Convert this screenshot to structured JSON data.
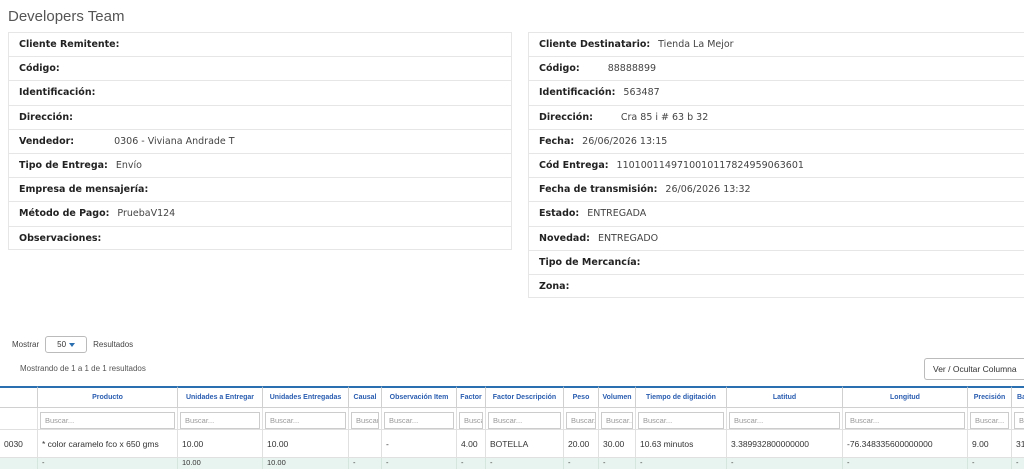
{
  "app_title": "Developers Team",
  "sender": [
    {
      "label": "Cliente Remitente:",
      "value": ""
    },
    {
      "label": "Código:",
      "value": ""
    },
    {
      "label": "Identificación:",
      "value": ""
    },
    {
      "label": "Dirección:",
      "value": ""
    },
    {
      "label": "Vendedor:",
      "value": "0306 - Viviana Andrade T"
    },
    {
      "label": "Tipo de Entrega:",
      "value": "Envío"
    },
    {
      "label": "Empresa de mensajería:",
      "value": ""
    },
    {
      "label": "Método de Pago:",
      "value": "PruebaV124"
    },
    {
      "label": "Observaciones:",
      "value": ""
    }
  ],
  "receiver": [
    {
      "label": "Cliente Destinatario:",
      "value": "Tienda La Mejor"
    },
    {
      "label": "Código:",
      "value": "88888899"
    },
    {
      "label": "Identificación:",
      "value": "563487"
    },
    {
      "label": "Dirección:",
      "value": "Cra 85 i # 63 b 32"
    },
    {
      "label": "Fecha:",
      "value": "26/06/2026 13:15"
    },
    {
      "label": "Cód Entrega:",
      "value": "1101001149710010117824959063601"
    },
    {
      "label": "Fecha de transmisión:",
      "value": "26/06/2026 13:32"
    },
    {
      "label": "Estado:",
      "value": "ENTREGADA"
    },
    {
      "label": "Novedad:",
      "value": "ENTREGADO"
    },
    {
      "label": "Tipo de Mercancía:",
      "value": ""
    },
    {
      "label": "Zona:",
      "value": ""
    }
  ],
  "table_controls": {
    "show_label": "Mostrar",
    "page_size": "50",
    "results_label": "Resultados",
    "showing_text": "Mostrando de 1 a 1 de 1 resultados",
    "toggle_columns": "Ver / Ocultar Columna"
  },
  "table": {
    "search_placeholder": "Buscar...",
    "columns": [
      "",
      "Producto",
      "Unidades a Entregar",
      "Unidades Entregadas",
      "Causal",
      "Observación Item",
      "Factor",
      "Factor Descripción",
      "Peso",
      "Volumen",
      "Tiempo de digitación",
      "Latitud",
      "Longitud",
      "Precisión",
      "Ba"
    ],
    "row": [
      "0030",
      "* color caramelo fco x 650 gms",
      "10.00",
      "10.00",
      "",
      "-",
      "4.00",
      "BOTELLA",
      "20.00",
      "30.00",
      "10.63 minutos",
      "3.389932800000000",
      "-76.348335600000000",
      "9.00",
      "31"
    ],
    "totals": [
      "",
      "-",
      "10.00",
      "10.00",
      "-",
      "-",
      "-",
      "-",
      "-",
      "-",
      "-",
      "-",
      "-",
      "-",
      "-"
    ]
  }
}
